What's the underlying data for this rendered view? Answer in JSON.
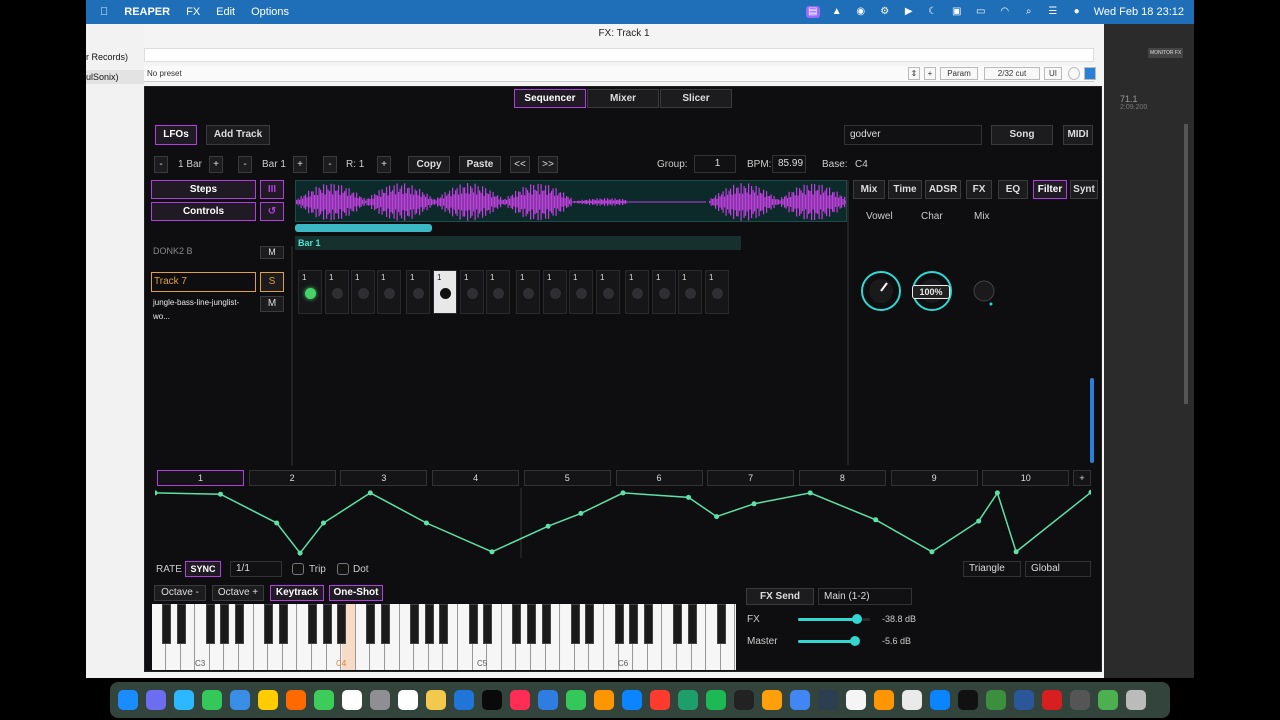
{
  "menubar": {
    "apple": "",
    "app": "REAPER",
    "items": [
      "FX",
      "Edit",
      "Options"
    ],
    "datetime": "Wed Feb 18  23:12"
  },
  "window": {
    "title": "FX: Track 1",
    "left_label_1": "r Records)",
    "left_label_2": "ulSonix)"
  },
  "presetbar": {
    "preset": "No preset",
    "plus": "+",
    "param": "Param",
    "cut": "2/32 cut",
    "ui": "UI"
  },
  "rightpane": {
    "monitor": "MONITOR FX",
    "time": "71.1",
    "time2": "2:09.200"
  },
  "top_tabs": [
    "Sequencer",
    "Mixer",
    "Slicer"
  ],
  "toolbar": {
    "lfos": "LFOs",
    "add_track": "Add Track",
    "search_value": "godver",
    "song": "Song",
    "midi": "MIDI"
  },
  "controls": {
    "minus": "-",
    "plus": "+",
    "len": "1 Bar",
    "bar": "Bar 1",
    "r": "R: 1",
    "copy": "Copy",
    "paste": "Paste",
    "prev": "<<",
    "next": ">>",
    "group_label": "Group:",
    "group_value": "1",
    "bpm_label": "BPM:",
    "bpm_value": "85.99",
    "base_label": "Base:",
    "base_value": "C4"
  },
  "side": {
    "steps": "Steps",
    "controls": "Controls",
    "steps_icon": "III",
    "controls_icon": "↺"
  },
  "tracks": {
    "prev_name": "DONK2 B",
    "prev_btn": "M",
    "name": "Track 7",
    "solo": "S",
    "sample": "jungle-bass-line-junglist-wo...",
    "mute": "M"
  },
  "bar_label": "Bar 1",
  "steps": [
    {
      "n": "1",
      "state": "active"
    },
    {
      "n": "1",
      "state": "off"
    },
    {
      "n": "1",
      "state": "off"
    },
    {
      "n": "1",
      "state": "off"
    },
    {
      "n": "1",
      "state": "off"
    },
    {
      "n": "1",
      "state": "selected"
    },
    {
      "n": "1",
      "state": "off"
    },
    {
      "n": "1",
      "state": "off"
    },
    {
      "n": "1",
      "state": "off"
    },
    {
      "n": "1",
      "state": "off"
    },
    {
      "n": "1",
      "state": "off"
    },
    {
      "n": "1",
      "state": "off"
    },
    {
      "n": "1",
      "state": "off"
    },
    {
      "n": "1",
      "state": "off"
    },
    {
      "n": "1",
      "state": "off"
    },
    {
      "n": "1",
      "state": "off"
    }
  ],
  "fx_tabs": [
    "Mix",
    "Time",
    "ADSR",
    "FX",
    "EQ",
    "Filter",
    "Synt"
  ],
  "fx_active": "Filter",
  "knobs": [
    {
      "label": "Vowel",
      "value": ""
    },
    {
      "label": "Char",
      "value": "100%"
    },
    {
      "label": "Mix",
      "value": ""
    }
  ],
  "lfo_tabs": [
    "1",
    "2",
    "3",
    "4",
    "5",
    "6",
    "7",
    "8",
    "9",
    "10"
  ],
  "lfo_add": "+",
  "lfo_points": [
    [
      0,
      0.03
    ],
    [
      0.07,
      0.05
    ],
    [
      0.13,
      0.5
    ],
    [
      0.155,
      0.97
    ],
    [
      0.18,
      0.5
    ],
    [
      0.23,
      0.03
    ],
    [
      0.29,
      0.5
    ],
    [
      0.36,
      0.95
    ],
    [
      0.42,
      0.55
    ],
    [
      0.455,
      0.35
    ],
    [
      0.5,
      0.03
    ],
    [
      0.57,
      0.1
    ],
    [
      0.6,
      0.4
    ],
    [
      0.64,
      0.2
    ],
    [
      0.7,
      0.03
    ],
    [
      0.77,
      0.45
    ],
    [
      0.83,
      0.95
    ],
    [
      0.88,
      0.47
    ],
    [
      0.9,
      0.03
    ],
    [
      0.92,
      0.95
    ],
    [
      1,
      0.02
    ]
  ],
  "lfo_controls": {
    "rate": "RATE",
    "sync": "SYNC",
    "rate_value": "1/1",
    "trip": "Trip",
    "dot": "Dot",
    "shape": "Triangle",
    "scope": "Global"
  },
  "keyboard": {
    "oct_down": "Octave -",
    "oct_up": "Octave +",
    "keytrack": "Keytrack",
    "oneshot": "One-Shot",
    "labels": [
      "C3",
      "C4",
      "C5",
      "C6"
    ]
  },
  "sends": {
    "fx_send": "FX Send",
    "main": "Main (1-2)",
    "fx": "FX",
    "fx_db": "-38.8 dB",
    "fx_level": 0.82,
    "master": "Master",
    "master_db": "-5.6 dB",
    "master_level": 0.92
  },
  "colors": {
    "accent": "#b23ee0",
    "teal": "#33d6d0",
    "wave": "#c13fe0"
  }
}
